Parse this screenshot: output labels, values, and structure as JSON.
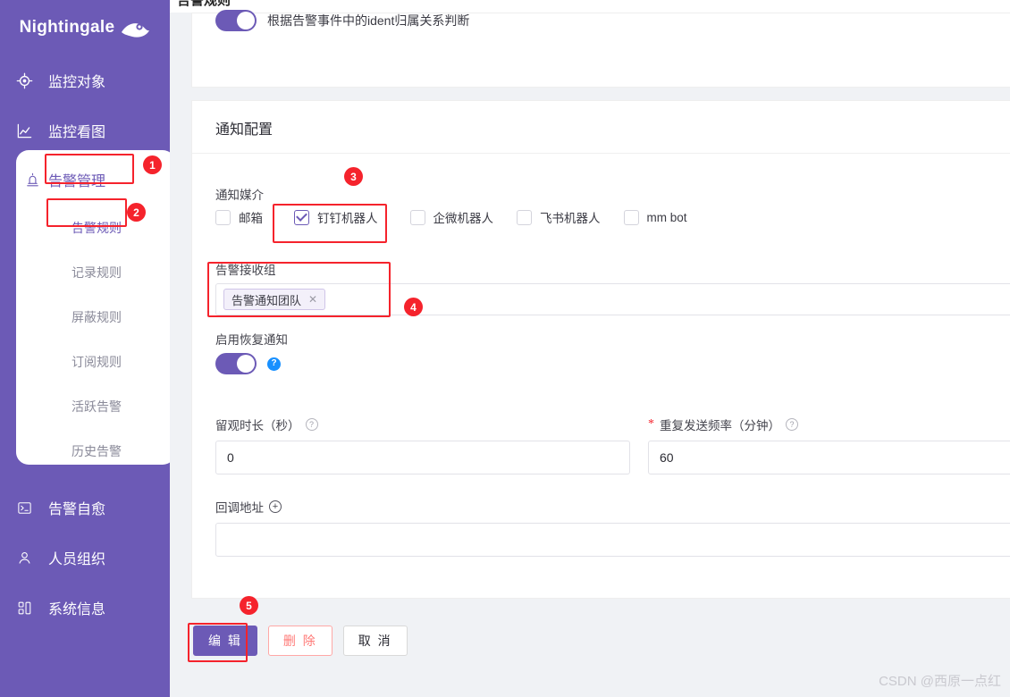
{
  "brand": {
    "name": "Nightingale",
    "logo_icon": "bird-logo-icon"
  },
  "sidebar": {
    "background_color": "#6c5ab6",
    "top_items": [
      {
        "label": "监控对象",
        "icon": "target-icon"
      },
      {
        "label": "监控看图",
        "icon": "chart-line-icon"
      }
    ],
    "open_group": {
      "label": "告警管理",
      "icon": "alarm-bell-icon",
      "children": [
        {
          "label": "告警规则",
          "active": true
        },
        {
          "label": "记录规则",
          "active": false
        },
        {
          "label": "屏蔽规则",
          "active": false
        },
        {
          "label": "订阅规则",
          "active": false
        },
        {
          "label": "活跃告警",
          "active": false
        },
        {
          "label": "历史告警",
          "active": false
        }
      ]
    },
    "bottom_items": [
      {
        "label": "告警自愈",
        "icon": "terminal-icon"
      },
      {
        "label": "人员组织",
        "icon": "user-icon"
      },
      {
        "label": "系统信息",
        "icon": "apps-grid-icon"
      }
    ]
  },
  "breadcrumb": "告警规则",
  "cards": {
    "top_card": {
      "toggle_on": true,
      "toggle_caption": "根据告警事件中的ident归属关系判断"
    },
    "notify_card": {
      "title": "通知配置",
      "media_label": "通知媒介",
      "media_options": [
        {
          "label": "邮箱",
          "checked": false
        },
        {
          "label": "钉钉机器人",
          "checked": true
        },
        {
          "label": "企微机器人",
          "checked": false
        },
        {
          "label": "飞书机器人",
          "checked": false
        },
        {
          "label": "mm bot",
          "checked": false
        }
      ],
      "receiver_group": {
        "label": "告警接收组",
        "tags": [
          {
            "text": "告警通知团队",
            "remove_icon": "close-x-icon"
          }
        ]
      },
      "recover_notify": {
        "label": "启用恢复通知",
        "toggle_on": true,
        "help_icon": "question-circle-filled-icon"
      },
      "observe_duration": {
        "label": "留观时长（秒）",
        "help_icon": "question-circle-icon",
        "value": "0",
        "required": false
      },
      "repeat_frequency": {
        "label": "重复发送频率（分钟）",
        "help_icon": "question-circle-icon",
        "value": "60",
        "required": true,
        "required_mark": "*"
      },
      "callback": {
        "label": "回调地址",
        "add_icon": "plus-circle-icon",
        "value": ""
      }
    }
  },
  "footer_buttons": [
    {
      "label": "编 辑",
      "style": "primary"
    },
    {
      "label": "删 除",
      "style": "danger"
    },
    {
      "label": "取 消",
      "style": "default"
    }
  ],
  "annotations": [
    {
      "number": "1",
      "target": "sidebar-group-alerting"
    },
    {
      "number": "2",
      "target": "sidebar-subitem-alert-rules"
    },
    {
      "number": "3",
      "target": "dingtalk-robot-checkbox"
    },
    {
      "number": "4",
      "target": "receiver-group-select"
    },
    {
      "number": "5",
      "target": "edit-button"
    }
  ],
  "watermark": "CSDN @西原一点红",
  "colors": {
    "brand_purple": "#6c5ab6",
    "annotation_red": "#f5232c",
    "danger": "#ff7875",
    "help_blue": "#1890ff"
  }
}
